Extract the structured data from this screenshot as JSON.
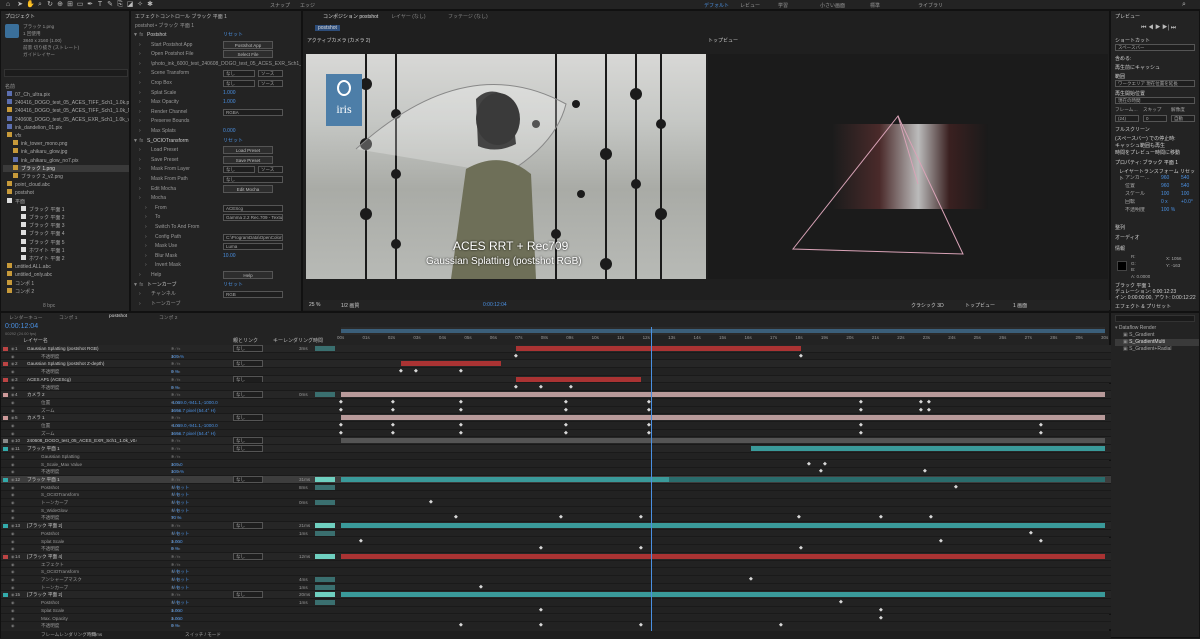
{
  "workspaces": [
    {
      "label": "デフォルト",
      "active": true
    },
    {
      "label": "レビュー",
      "active": false
    },
    {
      "label": "学習",
      "active": false
    },
    {
      "label": "小さい画面",
      "active": false
    },
    {
      "label": "標準",
      "active": false
    },
    {
      "label": "ライブラリ",
      "active": false
    }
  ],
  "toolbar_labels": {
    "snap": "スナップ",
    "universal": "エッジ"
  },
  "project": {
    "tab": "プロジェクト",
    "effects_tab": "エフェクトコントロール ブラック 平面 1",
    "selected_info": [
      "ブラック 1.png",
      "1 回使用",
      "3840 x 2160 (1.00)",
      "前景 切り抜き (ストレート)",
      "ガイドレイヤー"
    ],
    "column_name": "名前",
    "files": [
      "07_Ch_ultra.pix",
      "240416_DOGO_test_05_ACES_TIFF_Sch1_1.0k.pix",
      "240416_DOGO_test_05_ACES_TIFF_Sch1_1.0k_NoCrop",
      "240608_DOGO_test_05_ACES_EXR_Sch1_1.0k_v0.09.pix",
      "ink_dandelion_01.pix",
      "vfx",
      "ink_tower_mono.png",
      "ink_ahikaru_glow.jpg",
      "ink_ahikaru_glow_no7.pix",
      "ブラック 1.png",
      "ブラック 2_v2.png",
      "point_cloud.abc",
      "postshot",
      "平面",
      "ブラック 平面 1",
      "ブラック 平面 2",
      "ブラック 平面 3",
      "ブラック 平面 4",
      "ブラック 平面 5",
      "ホワイト 平面 1",
      "ホワイト 平面 2",
      "untitled.ALL.abc",
      "untitled_only.abc",
      "コンポ 1",
      "コンポ 2"
    ],
    "bottom_info": "8 bpc"
  },
  "effects": {
    "header": "postshot • ブラック 平面 1",
    "rows": [
      {
        "label": "Postshot",
        "value": "リセット",
        "indent": 0
      },
      {
        "label": "Start Postshot App",
        "button": "Postshot App",
        "indent": 1
      },
      {
        "label": "Open Postshot File",
        "button": "Select File",
        "indent": 1
      },
      {
        "label": "\\photo_ink_6000_test_240608_DOGO_test_05_ACES_EXR_Sch1_1.0k_v0.09.pshl",
        "indent": 1
      },
      {
        "label": "Scene Transform",
        "drop": "なし",
        "drop2": "ソース",
        "indent": 1
      },
      {
        "label": "Crop Box",
        "drop": "なし",
        "drop2": "ソース",
        "indent": 1
      },
      {
        "label": "Splat Scale",
        "value": "1.000",
        "indent": 1
      },
      {
        "label": "Max Opacity",
        "value": "1.000",
        "indent": 1
      },
      {
        "label": "Render Channel",
        "drop": "RGBA",
        "indent": 1
      },
      {
        "label": "Preserve Bounds",
        "indent": 1
      },
      {
        "label": "Max Splats",
        "value": "0.000",
        "indent": 1
      },
      {
        "label": "S_OCIOTransform",
        "value": "リセット",
        "indent": 0
      },
      {
        "label": "Load Preset",
        "button": "Load Preset",
        "indent": 1
      },
      {
        "label": "Save Preset",
        "button": "Save Preset",
        "indent": 1
      },
      {
        "label": "Mask From Layer",
        "drop": "なし",
        "drop2": "ソース",
        "indent": 1
      },
      {
        "label": "Mask From Path",
        "drop": "なし",
        "indent": 1
      },
      {
        "label": "Edit Mocha",
        "button": "Edit Mocha",
        "indent": 1
      },
      {
        "label": "Mocha",
        "indent": 1
      },
      {
        "label": "From",
        "drop": "ACEScg",
        "indent": 2
      },
      {
        "label": "To",
        "drop": "Gamma 2.2 Rec.709 - Texture",
        "indent": 2
      },
      {
        "label": "Switch To And From",
        "indent": 2
      },
      {
        "label": "Config Path",
        "drop": "C:\\ProgramData\\OpenColorIO\\",
        "indent": 2
      },
      {
        "label": "Mask Use",
        "drop": "Luma",
        "indent": 2
      },
      {
        "label": "Blur Mask",
        "value": "10.00",
        "indent": 2
      },
      {
        "label": "Invert Mask",
        "indent": 2
      },
      {
        "label": "Help",
        "button": "Help",
        "indent": 1
      },
      {
        "label": "トーンカーブ",
        "value": "リセット",
        "indent": 0
      },
      {
        "label": "チャンネル",
        "drop": "RGB",
        "indent": 1
      },
      {
        "label": "トーンカーブ",
        "indent": 1
      }
    ]
  },
  "comp": {
    "tab": "コンポジション postshot",
    "tab2": "レイヤー (なし)",
    "tab3": "フッテージ (なし)",
    "sub_tab": "postshot",
    "view_left": "アクティブカメラ (カメラ 2)",
    "view_right": "トップビュー",
    "logo": "iris",
    "overlay_title": "ACES RRT + Rec709",
    "overlay_subtitle": "Gaussian Splatting (postshot RGB)",
    "zoom": "25 %",
    "res": "1/2 画質",
    "timecode": "0:00:12:04",
    "renderer": "クラシック 3D",
    "view_select": "トップビュー",
    "views": "1 画面"
  },
  "right": {
    "preview_tab": "プレビュー",
    "shortcut_label": "ショートカット",
    "shortcut": "スペースバー",
    "include": "含める:",
    "cache_label": "再生前にキャッシュ",
    "range_label": "範囲",
    "range": "ワークエリア 現在位置を延長",
    "play_from": "再生開始位置",
    "play_from_val": "現在の時間",
    "fps_head": [
      "フレーム…",
      "スキップ",
      "解像度"
    ],
    "fps": [
      "(24)",
      "0",
      "自動"
    ],
    "fullscreen": "フルスクリーン",
    "stop_label": "(スペースバー) での停止時:",
    "stop_opt1": "キャッシュ範囲も再生",
    "stop_opt2": "時間をプレビュー時間に移動",
    "props_tab": "プロパティ: ブラック 平面 1",
    "layer_transform": "レイヤートランスフォーム リセット",
    "props": [
      {
        "label": "アンカー…",
        "x": "960",
        "y": "540"
      },
      {
        "label": "位置",
        "x": "960",
        "y": "540"
      },
      {
        "label": "スケール",
        "x": "100",
        "y": "100"
      },
      {
        "label": "回転",
        "x": "0 x",
        "y": "+0.0°"
      },
      {
        "label": "不透明度",
        "x": "100 %",
        "y": ""
      }
    ],
    "align_tab": "整列",
    "audio_tab": "オーディオ",
    "info_tab": "情報",
    "info_rgb": [
      "R: ",
      "G: ",
      "B: ",
      "A: 0.0000"
    ],
    "info_xy": [
      "X: 1056",
      "Y: -163"
    ],
    "info_layer": "ブラック 平面 1",
    "info_dur": "デュレーション: 0:00:12:23",
    "info_inout": "イン: 0:00:00:00, アウト: 0:00:12:22",
    "fx_tab": "エフェクト & プリセット",
    "fx_search": "",
    "fx_tree": [
      "Dataflow Render",
      "S_Gradient",
      "S_GradientMulti",
      "S_Gradient+Radial"
    ]
  },
  "timeline": {
    "tabs": [
      "レンダーキュー",
      "コンポ 1",
      "postshot",
      "コンポ 2"
    ],
    "timecode": "0:00:12:04",
    "timecode_sub": "00292 (24.00 fps)",
    "col_headers": [
      "レイヤー名",
      "親とリンク",
      "キー",
      "レンダリング時間"
    ],
    "ruler": [
      "00s",
      "01s",
      "02s",
      "03s",
      "04s",
      "05s",
      "06s",
      "07s",
      "08s",
      "09s",
      "10s",
      "11s",
      "12s",
      "13s",
      "14s",
      "15s",
      "16s",
      "17s",
      "18s",
      "19s",
      "20s",
      "21s",
      "22s",
      "23s",
      "24s",
      "25s",
      "26s",
      "27s",
      "28s",
      "29s",
      "30s"
    ],
    "rows": [
      {
        "num": "1",
        "name": "Gaussian Splatting (postshot RGB)",
        "color": "#b44",
        "parent": "なし",
        "time": "3ms"
      },
      {
        "num": "",
        "name": "不透明度",
        "color": "",
        "parent": "",
        "time": "",
        "val": "100 %"
      },
      {
        "num": "2",
        "name": "Gaussian Splatting (postshot Z-depth)",
        "color": "#b44",
        "parent": "なし",
        "time": ""
      },
      {
        "num": "",
        "name": "不透明度",
        "color": "",
        "parent": "",
        "time": "",
        "val": "0 %"
      },
      {
        "num": "3",
        "name": "ACES AP1 (ACEScg)",
        "color": "#b44",
        "parent": "なし",
        "time": ""
      },
      {
        "num": "",
        "name": "不透明度",
        "color": "",
        "parent": "",
        "time": "",
        "val": "0 %"
      },
      {
        "num": "4",
        "name": "カメラ 2",
        "color": "#c99",
        "parent": "なし",
        "time": "0ms"
      },
      {
        "num": "",
        "name": "位置",
        "color": "",
        "parent": "",
        "time": "",
        "val": "-1009.0,-941.1,-1000.0"
      },
      {
        "num": "",
        "name": "ズーム",
        "color": "",
        "parent": "",
        "time": "",
        "val": "1666.7 pixel (54.4° H)"
      },
      {
        "num": "5",
        "name": "カメラ 1",
        "color": "#c99",
        "parent": "なし",
        "time": ""
      },
      {
        "num": "",
        "name": "位置",
        "color": "",
        "parent": "",
        "time": "",
        "val": "-1009.0,-941.1,-1000.0"
      },
      {
        "num": "",
        "name": "ズーム",
        "color": "",
        "parent": "",
        "time": "",
        "val": "1666.7 pixel (54.4° H)"
      },
      {
        "num": "10",
        "name": "240608_DOGO_test_05_ACES_EXR_Sch1_1.0k_v0.09.pix",
        "color": "#888",
        "parent": "なし",
        "time": ""
      },
      {
        "num": "11",
        "name": "ブラック 平面 1",
        "color": "#3aa",
        "parent": "なし",
        "time": ""
      },
      {
        "num": "",
        "name": "Gaussian Splatting",
        "color": "",
        "parent": "",
        "time": "",
        "val": ""
      },
      {
        "num": "",
        "name": "S_Scale_Max Value",
        "color": "",
        "parent": "",
        "time": "",
        "val": "100.0"
      },
      {
        "num": "",
        "name": "不透明度",
        "color": "",
        "parent": "",
        "time": "",
        "val": "100 %"
      },
      {
        "num": "12",
        "name": "ブラック 平面 1",
        "color": "#3aa",
        "parent": "なし",
        "time": "31ms",
        "selected": true
      },
      {
        "num": "",
        "name": "Postshot",
        "color": "",
        "parent": "",
        "time": "8ms",
        "val": "リセット"
      },
      {
        "num": "",
        "name": "S_OCIOTransform",
        "color": "",
        "parent": "",
        "time": "",
        "val": "リセット"
      },
      {
        "num": "",
        "name": "トーンカーブ",
        "color": "",
        "parent": "",
        "time": "0ms",
        "val": "リセット"
      },
      {
        "num": "",
        "name": "S_WideGlow",
        "color": "",
        "parent": "",
        "time": "",
        "val": "リセット"
      },
      {
        "num": "",
        "name": "不透明度",
        "color": "",
        "parent": "",
        "time": "",
        "val": "70 %"
      },
      {
        "num": "13",
        "name": "[ブラック 平面 2]",
        "color": "#3aa",
        "parent": "なし",
        "time": "21ms"
      },
      {
        "num": "",
        "name": "Postshot",
        "color": "",
        "parent": "",
        "time": "1ms",
        "val": "リセット"
      },
      {
        "num": "",
        "name": "Splat Scale",
        "color": "",
        "parent": "",
        "time": "",
        "val": "1.000"
      },
      {
        "num": "",
        "name": "不透明度",
        "color": "",
        "parent": "",
        "time": "",
        "val": "0 %"
      },
      {
        "num": "14",
        "name": "[ブラック 平面 4]",
        "color": "#b44",
        "parent": "なし",
        "time": "12ms"
      },
      {
        "num": "",
        "name": "エフェクト",
        "color": "",
        "parent": "",
        "time": "",
        "val": ""
      },
      {
        "num": "",
        "name": "S_OCIOTransform",
        "color": "",
        "parent": "",
        "time": "",
        "val": "リセット"
      },
      {
        "num": "",
        "name": "アンシャープマスク",
        "color": "",
        "parent": "",
        "time": "4ms",
        "val": "リセット"
      },
      {
        "num": "",
        "name": "トーンカーブ",
        "color": "",
        "parent": "",
        "time": "1ms",
        "val": "リセット"
      },
      {
        "num": "15",
        "name": "[ブラック 平面 2]",
        "color": "#3aa",
        "parent": "なし",
        "time": "20ms"
      },
      {
        "num": "",
        "name": "Postshot",
        "color": "",
        "parent": "",
        "time": "1ms",
        "val": "リセット"
      },
      {
        "num": "",
        "name": "Splat Scale",
        "color": "",
        "parent": "",
        "time": "",
        "val": "1.000"
      },
      {
        "num": "",
        "name": "Max. Opacity",
        "color": "",
        "parent": "",
        "time": "",
        "val": "1.000"
      },
      {
        "num": "",
        "name": "不透明度",
        "color": "",
        "parent": "",
        "time": "",
        "val": "0 %"
      },
      {
        "num": "16",
        "name": "[ブラック 平面 3]",
        "color": "#b44",
        "parent": "なし",
        "time": ""
      }
    ],
    "footer_left": "フレームレンダリング時間",
    "footer_val": "79ms",
    "footer_mode": "スイッチ / モード"
  },
  "colors": {
    "accent": "#4a90e2",
    "teal": "#3a9a9a",
    "red": "#a33",
    "pink": "#b88",
    "panel": "#232323",
    "bg": "#1d1d1d"
  }
}
